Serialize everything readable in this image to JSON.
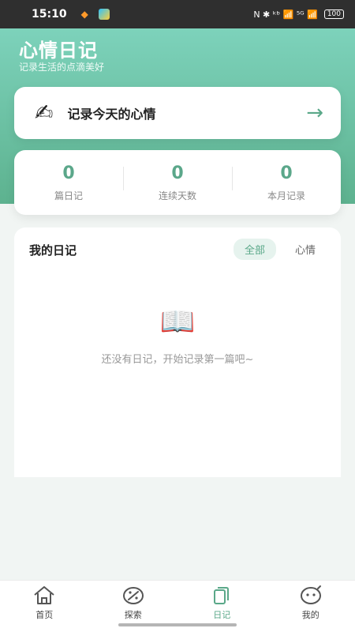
{
  "status_bar": {
    "time": "15:10",
    "right_text": "N ✱ ᵏᵇ 📶 ⁵ᴳ 📶",
    "battery": "100",
    "icons": [
      "app-orange-icon",
      "app-blue-icon",
      "nfc-icon",
      "bluetooth-icon",
      "wifi-icon",
      "signal-icon",
      "battery-icon"
    ]
  },
  "header": {
    "title": "心情日记",
    "subtitle": "记录生活的点滴美好"
  },
  "record_card": {
    "icon": "✍",
    "label": "记录今天的心情",
    "arrow": "→"
  },
  "stats": [
    {
      "value": "0",
      "label": "篇日记"
    },
    {
      "value": "0",
      "label": "连续天数"
    },
    {
      "value": "0",
      "label": "本月记录"
    }
  ],
  "diary_panel": {
    "title": "我的日记",
    "tabs": [
      {
        "label": "全部",
        "active": true
      },
      {
        "label": "心情",
        "active": false
      }
    ],
    "empty_icon": "📖",
    "empty_text": "还没有日记，开始记录第一篇吧~"
  },
  "bottom_nav": [
    {
      "label": "首页",
      "icon": "home-icon",
      "active": false
    },
    {
      "label": "探索",
      "icon": "explore-icon",
      "active": false
    },
    {
      "label": "日记",
      "icon": "diary-icon",
      "active": true
    },
    {
      "label": "我的",
      "icon": "profile-icon",
      "active": false
    }
  ],
  "colors": {
    "accent": "#5aa889",
    "header_top": "#7dd2bb",
    "header_bottom": "#5db28f",
    "background": "#f1f5f3"
  }
}
